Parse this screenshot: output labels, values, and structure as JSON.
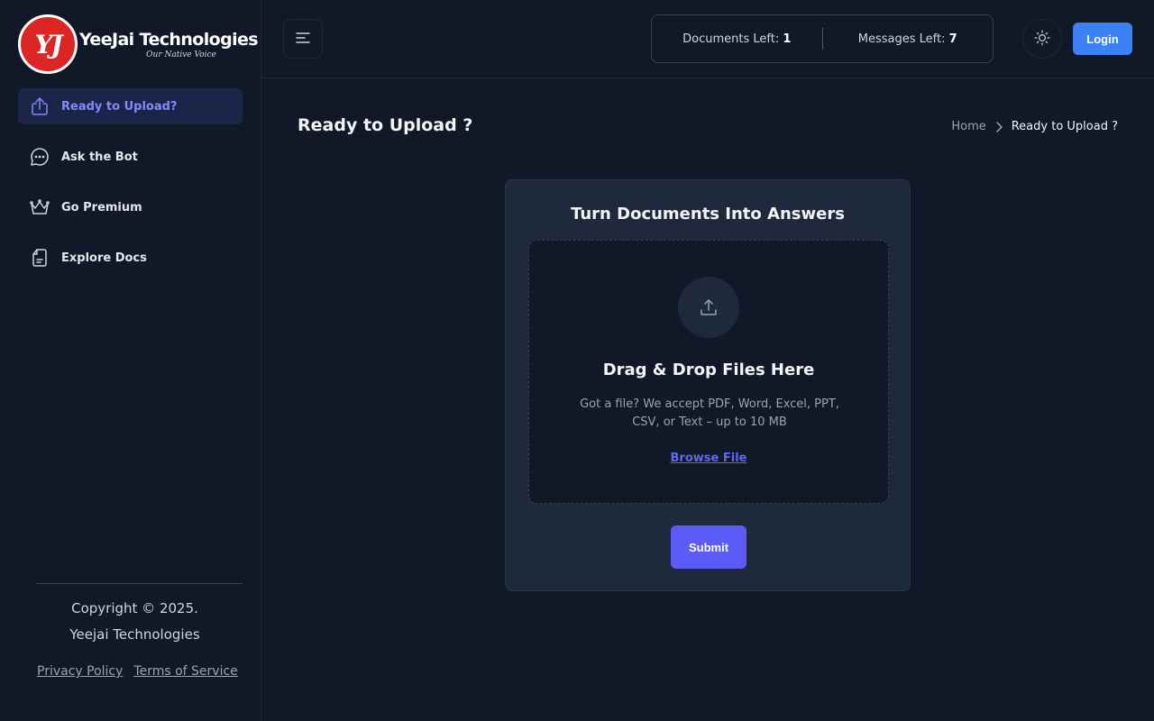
{
  "brand": {
    "logo_initials": "YJ",
    "name": "YeeJai Technologies",
    "tagline": "Our Native Voice"
  },
  "sidebar": {
    "items": [
      {
        "label": "Ready to Upload?",
        "icon": "upload-icon",
        "active": true
      },
      {
        "label": "Ask the Bot",
        "icon": "chat-bubble-icon",
        "active": false
      },
      {
        "label": "Go Premium",
        "icon": "crown-icon",
        "active": false
      },
      {
        "label": "Explore Docs",
        "icon": "document-icon",
        "active": false
      }
    ],
    "footer": {
      "copyright_line1": "Copyright © 2025.",
      "copyright_line2": "Yeejai Technologies",
      "privacy": "Privacy Policy",
      "terms": "Terms of Service"
    }
  },
  "header": {
    "documents_left_label": "Documents Left:",
    "documents_left_value": "1",
    "messages_left_label": "Messages Left:",
    "messages_left_value": "7",
    "login_label": "Login"
  },
  "page": {
    "title": "Ready to Upload ?",
    "breadcrumb": {
      "home": "Home",
      "current": "Ready to Upload ?"
    }
  },
  "upload_card": {
    "title": "Turn Documents Into Answers",
    "dropzone_title": "Drag & Drop Files Here",
    "dropzone_desc": "Got a file? We accept PDF, Word, Excel, PPT, CSV, or Text – up to 10 MB",
    "browse_label": "Browse File",
    "submit_label": "Submit"
  },
  "colors": {
    "background": "#111827",
    "accent": "#818cf8",
    "login": "#3b82f6",
    "submit": "#5b5bf5",
    "logo": "#dc2626"
  }
}
